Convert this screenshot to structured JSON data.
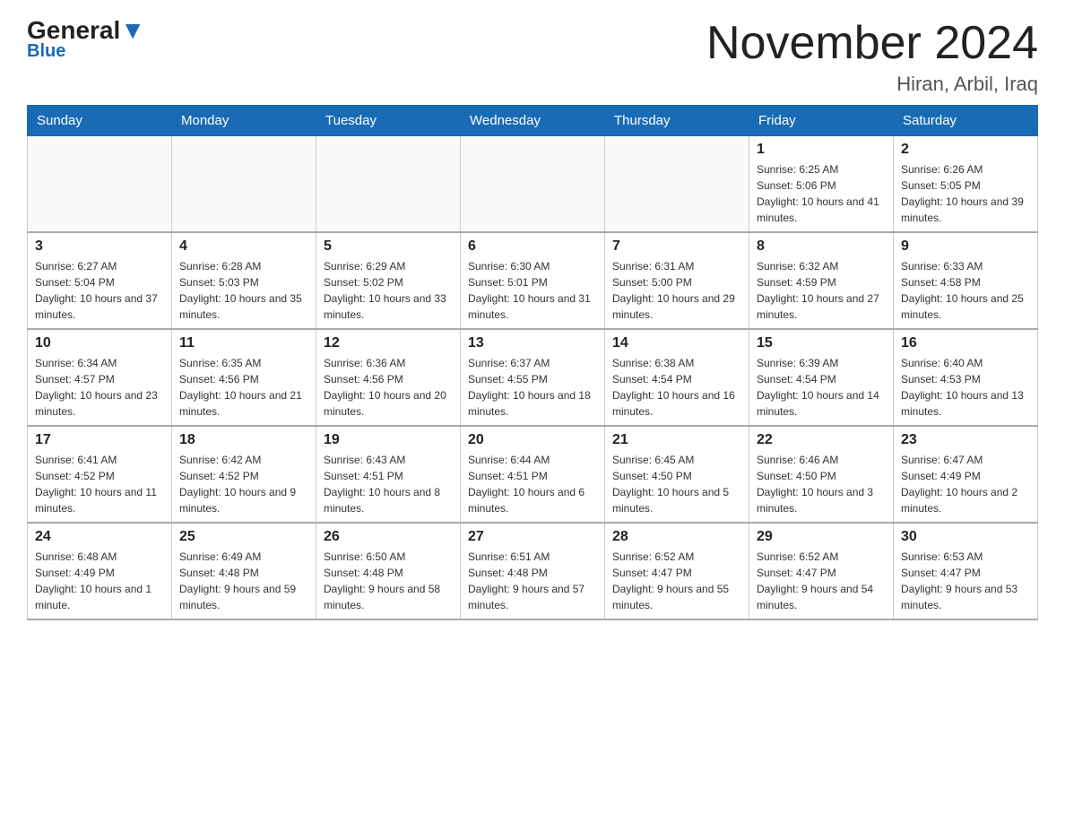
{
  "header": {
    "logo_main": "General",
    "logo_blue": "Blue",
    "month_title": "November 2024",
    "location": "Hiran, Arbil, Iraq"
  },
  "weekdays": [
    "Sunday",
    "Monday",
    "Tuesday",
    "Wednesday",
    "Thursday",
    "Friday",
    "Saturday"
  ],
  "weeks": [
    [
      {
        "day": "",
        "info": ""
      },
      {
        "day": "",
        "info": ""
      },
      {
        "day": "",
        "info": ""
      },
      {
        "day": "",
        "info": ""
      },
      {
        "day": "",
        "info": ""
      },
      {
        "day": "1",
        "info": "Sunrise: 6:25 AM\nSunset: 5:06 PM\nDaylight: 10 hours and 41 minutes."
      },
      {
        "day": "2",
        "info": "Sunrise: 6:26 AM\nSunset: 5:05 PM\nDaylight: 10 hours and 39 minutes."
      }
    ],
    [
      {
        "day": "3",
        "info": "Sunrise: 6:27 AM\nSunset: 5:04 PM\nDaylight: 10 hours and 37 minutes."
      },
      {
        "day": "4",
        "info": "Sunrise: 6:28 AM\nSunset: 5:03 PM\nDaylight: 10 hours and 35 minutes."
      },
      {
        "day": "5",
        "info": "Sunrise: 6:29 AM\nSunset: 5:02 PM\nDaylight: 10 hours and 33 minutes."
      },
      {
        "day": "6",
        "info": "Sunrise: 6:30 AM\nSunset: 5:01 PM\nDaylight: 10 hours and 31 minutes."
      },
      {
        "day": "7",
        "info": "Sunrise: 6:31 AM\nSunset: 5:00 PM\nDaylight: 10 hours and 29 minutes."
      },
      {
        "day": "8",
        "info": "Sunrise: 6:32 AM\nSunset: 4:59 PM\nDaylight: 10 hours and 27 minutes."
      },
      {
        "day": "9",
        "info": "Sunrise: 6:33 AM\nSunset: 4:58 PM\nDaylight: 10 hours and 25 minutes."
      }
    ],
    [
      {
        "day": "10",
        "info": "Sunrise: 6:34 AM\nSunset: 4:57 PM\nDaylight: 10 hours and 23 minutes."
      },
      {
        "day": "11",
        "info": "Sunrise: 6:35 AM\nSunset: 4:56 PM\nDaylight: 10 hours and 21 minutes."
      },
      {
        "day": "12",
        "info": "Sunrise: 6:36 AM\nSunset: 4:56 PM\nDaylight: 10 hours and 20 minutes."
      },
      {
        "day": "13",
        "info": "Sunrise: 6:37 AM\nSunset: 4:55 PM\nDaylight: 10 hours and 18 minutes."
      },
      {
        "day": "14",
        "info": "Sunrise: 6:38 AM\nSunset: 4:54 PM\nDaylight: 10 hours and 16 minutes."
      },
      {
        "day": "15",
        "info": "Sunrise: 6:39 AM\nSunset: 4:54 PM\nDaylight: 10 hours and 14 minutes."
      },
      {
        "day": "16",
        "info": "Sunrise: 6:40 AM\nSunset: 4:53 PM\nDaylight: 10 hours and 13 minutes."
      }
    ],
    [
      {
        "day": "17",
        "info": "Sunrise: 6:41 AM\nSunset: 4:52 PM\nDaylight: 10 hours and 11 minutes."
      },
      {
        "day": "18",
        "info": "Sunrise: 6:42 AM\nSunset: 4:52 PM\nDaylight: 10 hours and 9 minutes."
      },
      {
        "day": "19",
        "info": "Sunrise: 6:43 AM\nSunset: 4:51 PM\nDaylight: 10 hours and 8 minutes."
      },
      {
        "day": "20",
        "info": "Sunrise: 6:44 AM\nSunset: 4:51 PM\nDaylight: 10 hours and 6 minutes."
      },
      {
        "day": "21",
        "info": "Sunrise: 6:45 AM\nSunset: 4:50 PM\nDaylight: 10 hours and 5 minutes."
      },
      {
        "day": "22",
        "info": "Sunrise: 6:46 AM\nSunset: 4:50 PM\nDaylight: 10 hours and 3 minutes."
      },
      {
        "day": "23",
        "info": "Sunrise: 6:47 AM\nSunset: 4:49 PM\nDaylight: 10 hours and 2 minutes."
      }
    ],
    [
      {
        "day": "24",
        "info": "Sunrise: 6:48 AM\nSunset: 4:49 PM\nDaylight: 10 hours and 1 minute."
      },
      {
        "day": "25",
        "info": "Sunrise: 6:49 AM\nSunset: 4:48 PM\nDaylight: 9 hours and 59 minutes."
      },
      {
        "day": "26",
        "info": "Sunrise: 6:50 AM\nSunset: 4:48 PM\nDaylight: 9 hours and 58 minutes."
      },
      {
        "day": "27",
        "info": "Sunrise: 6:51 AM\nSunset: 4:48 PM\nDaylight: 9 hours and 57 minutes."
      },
      {
        "day": "28",
        "info": "Sunrise: 6:52 AM\nSunset: 4:47 PM\nDaylight: 9 hours and 55 minutes."
      },
      {
        "day": "29",
        "info": "Sunrise: 6:52 AM\nSunset: 4:47 PM\nDaylight: 9 hours and 54 minutes."
      },
      {
        "day": "30",
        "info": "Sunrise: 6:53 AM\nSunset: 4:47 PM\nDaylight: 9 hours and 53 minutes."
      }
    ]
  ]
}
